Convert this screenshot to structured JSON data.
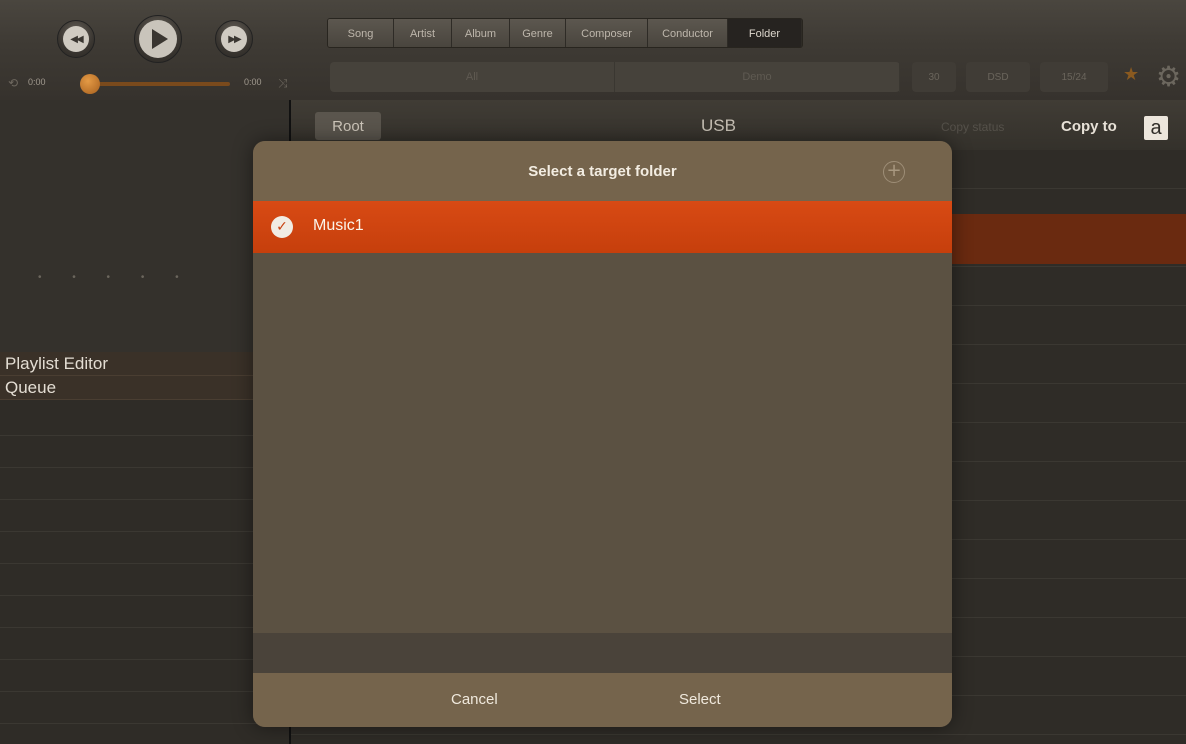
{
  "transport": {
    "prev_icon": "skip-back-icon",
    "play_icon": "play-icon",
    "next_icon": "skip-forward-icon",
    "elapsed": "0:00",
    "duration": "0:00",
    "progress": 0
  },
  "tabs": [
    "Song",
    "Artist",
    "Album",
    "Genre",
    "Composer",
    "Conductor",
    "Folder"
  ],
  "active_tab": "Folder",
  "filters": [
    "All",
    "Demo"
  ],
  "pills": [
    "30",
    "DSD",
    "15/24"
  ],
  "left_menu": [
    "Playlist Editor",
    "Queue"
  ],
  "dots": "• • • • •",
  "browser": {
    "back_label": "Root",
    "title": "USB",
    "copy_status_label": "Copy status",
    "copy_to_label": "Copy to",
    "sort_letter": "a"
  },
  "modal": {
    "title": "Select a target folder",
    "folders": [
      "Music1"
    ],
    "cancel_label": "Cancel",
    "select_label": "Select"
  },
  "colors": {
    "accent": "#d84a14",
    "modal_header": "#75644c",
    "progress_knob": "#e49a45"
  }
}
